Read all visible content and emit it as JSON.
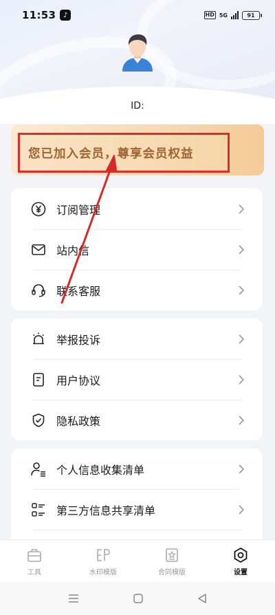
{
  "status_bar": {
    "time": "11:53",
    "network": "5G",
    "battery": "91",
    "hd": "HD"
  },
  "profile": {
    "id_label": "ID:"
  },
  "member": {
    "text": "您已加入会员，尊享会员权益"
  },
  "menu_group_1": [
    {
      "label": "订阅管理",
      "icon": "yen-circle-icon"
    },
    {
      "label": "站内信",
      "icon": "mail-icon"
    },
    {
      "label": "联系客服",
      "icon": "headset-icon"
    }
  ],
  "menu_group_2": [
    {
      "label": "举报投诉",
      "icon": "alarm-icon"
    },
    {
      "label": "用户协议",
      "icon": "document-icon"
    },
    {
      "label": "隐私政策",
      "icon": "shield-check-icon"
    }
  ],
  "menu_group_3": [
    {
      "label": "个人信息收集清单",
      "icon": "person-list-icon"
    },
    {
      "label": "第三方信息共享清单",
      "icon": "grid-list-icon"
    }
  ],
  "tabs": [
    {
      "label": "工具",
      "icon": "toolbox-icon",
      "active": false
    },
    {
      "label": "水印模版",
      "icon": "watermark-icon",
      "active": false
    },
    {
      "label": "合同模版",
      "icon": "contract-icon",
      "active": false
    },
    {
      "label": "设置",
      "icon": "hexagon-gear-icon",
      "active": true
    }
  ],
  "colors": {
    "highlight_box": "#e02b26",
    "member_text": "#a06530",
    "accent_gold": "#f4cb96"
  }
}
